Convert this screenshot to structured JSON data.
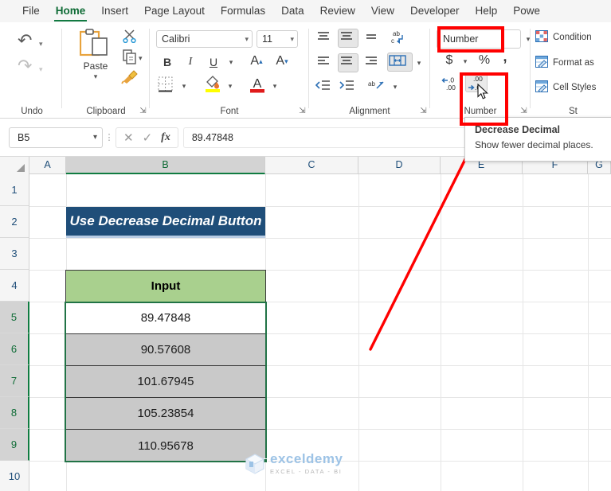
{
  "ribbon": {
    "tabs": [
      {
        "label": "File",
        "active": false
      },
      {
        "label": "Home",
        "active": true
      },
      {
        "label": "Insert",
        "active": false
      },
      {
        "label": "Page Layout",
        "active": false
      },
      {
        "label": "Formulas",
        "active": false
      },
      {
        "label": "Data",
        "active": false
      },
      {
        "label": "Review",
        "active": false
      },
      {
        "label": "View",
        "active": false
      },
      {
        "label": "Developer",
        "active": false
      },
      {
        "label": "Help",
        "active": false
      },
      {
        "label": "Powe",
        "active": false
      }
    ],
    "groups": {
      "undo": {
        "label": "Undo",
        "undo_icon": "undo-arrow-icon",
        "redo_icon": "redo-arrow-icon"
      },
      "clipboard": {
        "label": "Clipboard",
        "paste_label": "Paste",
        "cut_icon": "scissors-icon",
        "copy_icon": "copy-icon",
        "format_painter_icon": "format-painter-icon"
      },
      "font": {
        "label": "Font",
        "font_name": "Calibri",
        "font_size": "11",
        "bold": "B",
        "italic": "I",
        "underline": "U",
        "grow_font": "A",
        "shrink_font": "A",
        "borders_icon": "borders-icon",
        "fill_color_icon": "fill-color-icon",
        "font_color_icon": "font-color-icon"
      },
      "alignment": {
        "label": "Alignment",
        "wrap_text": "ab",
        "merge_center_icon": "merge-center-icon",
        "orientation_icon": "orientation-icon"
      },
      "number": {
        "label": "Number",
        "format_value": "Number",
        "accounting": "$",
        "percent": "%",
        "comma": ",",
        "increase_decimal_icon": "increase-decimal-icon",
        "decrease_decimal_icon": "decrease-decimal-icon"
      },
      "styles": {
        "label": "St",
        "items": [
          "Condition",
          "Format as",
          "Cell Styles"
        ]
      }
    }
  },
  "tooltip": {
    "title": "Decrease Decimal",
    "body": "Show fewer decimal places."
  },
  "formula_bar": {
    "name_box": "B5",
    "cancel_icon": "cancel-x-icon",
    "enter_icon": "enter-check-icon",
    "function_icon": "fx-icon",
    "value": "89.47848"
  },
  "grid": {
    "columns": [
      "A",
      "B",
      "C",
      "D",
      "E",
      "F",
      "G"
    ],
    "selected_column": "B",
    "rows": [
      "1",
      "2",
      "3",
      "4",
      "5",
      "6",
      "7",
      "8",
      "9",
      "10"
    ],
    "selected_rows": [
      "5",
      "6",
      "7",
      "8",
      "9"
    ],
    "title_cell": "Use Decrease Decimal Button",
    "header_cell": "Input",
    "data_cells": [
      "89.47848",
      "90.57608",
      "101.67945",
      "105.23854",
      "110.95678"
    ]
  },
  "watermark": {
    "name": "exceldemy",
    "tagline": "EXCEL - DATA - BI",
    "logo_icon": "cube-logo-icon"
  },
  "colors": {
    "accent_green": "#107c41",
    "annotation_red": "#ff0000",
    "title_banner": "#1f4e79",
    "header_fill": "#a9d08e",
    "row_fill": "#c9c9c9"
  }
}
